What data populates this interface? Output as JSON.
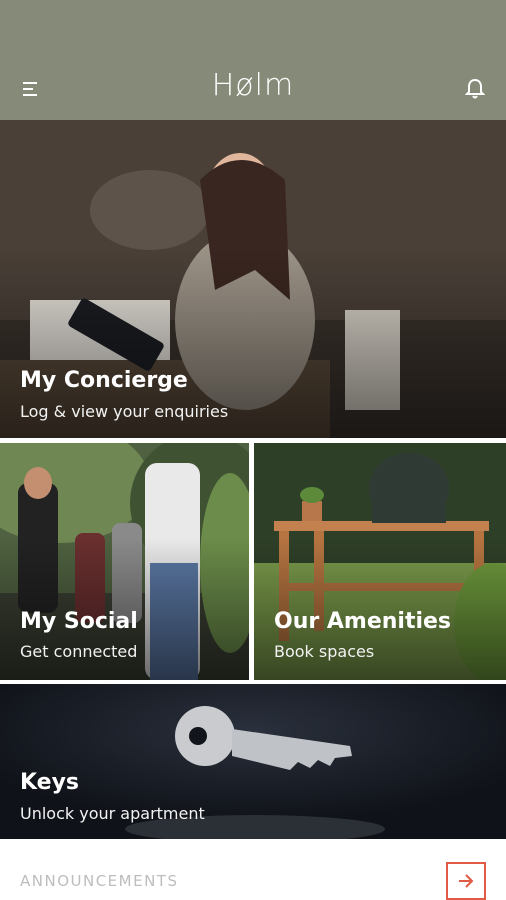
{
  "header": {
    "brand": "Hølm",
    "menu_icon": "hamburger-menu-icon",
    "notifications_icon": "bell-icon",
    "background": "#858b78"
  },
  "cards": {
    "concierge": {
      "title": "My Concierge",
      "subtitle": "Log & view your enquiries"
    },
    "social": {
      "title": "My Social",
      "subtitle": "Get connected"
    },
    "amenities": {
      "title": "Our Amenities",
      "subtitle": "Book spaces"
    },
    "keys": {
      "title": "Keys",
      "subtitle": "Unlock your apartment"
    }
  },
  "announcements": {
    "label": "ANNOUNCEMENTS",
    "arrow_icon": "arrow-right-icon",
    "accent": "#e05a45"
  }
}
